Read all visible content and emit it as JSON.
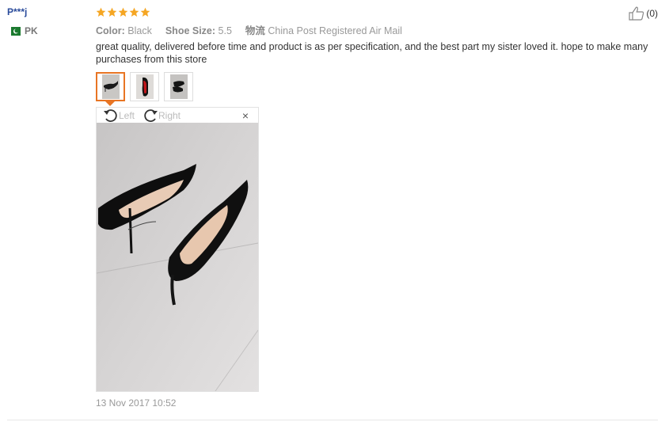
{
  "reviewer": {
    "name": "P***j",
    "country": "PK"
  },
  "rating": {
    "stars": 5,
    "max": 5
  },
  "helpful": {
    "count_label": "(0)"
  },
  "attributes": {
    "color_label": "Color:",
    "color_value": "Black",
    "size_label": "Shoe Size:",
    "size_value": "5.5",
    "logistics_label": "物流",
    "logistics_value": "China Post Registered Air Mail"
  },
  "review_text": "great quality, delivered before time and product is as per specification, and the best part my sister loved it. hope to make many purchases from this store",
  "viewer": {
    "rotate_left_label": "Left",
    "rotate_right_label": "Right",
    "close_label": "×"
  },
  "date": "13 Nov 2017 10:52",
  "colors": {
    "star": "#f5a623",
    "accent": "#e87524",
    "username": "#2a4b9b"
  }
}
